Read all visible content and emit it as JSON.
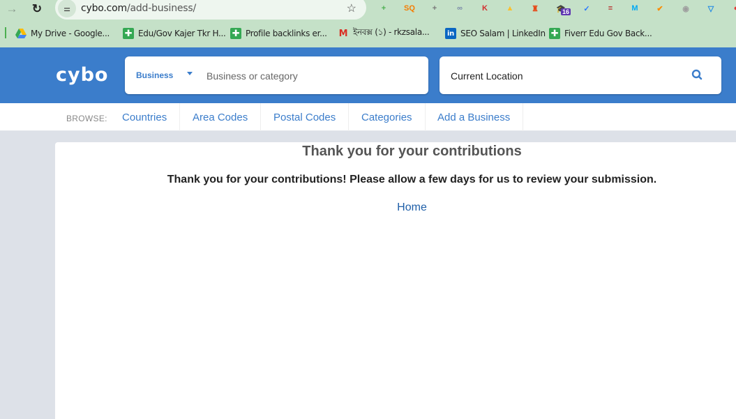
{
  "browser": {
    "url_host": "cybo.com",
    "url_path": "/add-business/",
    "extensions": [
      {
        "name": "extension-plus",
        "glyph": "+",
        "color": "#4caf50"
      },
      {
        "name": "extension-sq",
        "glyph": "SQ",
        "color": "#f57c00"
      },
      {
        "name": "extension-doc-plus",
        "glyph": "+",
        "color": "#777"
      },
      {
        "name": "extension-link",
        "glyph": "∞",
        "color": "#7a8aa8"
      },
      {
        "name": "extension-k",
        "glyph": "K",
        "color": "#d32f2f"
      },
      {
        "name": "extension-bell",
        "glyph": "▲",
        "color": "#fbc02d"
      },
      {
        "name": "extension-lighthouse",
        "glyph": "♜",
        "color": "#e64a19"
      },
      {
        "name": "extension-cap",
        "glyph": "🎓",
        "color": "#5e35b1",
        "badge": "16"
      },
      {
        "name": "extension-calendar",
        "glyph": "✓",
        "color": "#2979ff"
      },
      {
        "name": "extension-flag",
        "glyph": "≡",
        "color": "#b71c1c"
      },
      {
        "name": "extension-m",
        "glyph": "M",
        "color": "#03a9f4"
      },
      {
        "name": "extension-user-check",
        "glyph": "✔",
        "color": "#fb8c00"
      },
      {
        "name": "extension-shield-gray",
        "glyph": "◉",
        "color": "#9e9e9e"
      },
      {
        "name": "extension-shield-blue",
        "glyph": "▽",
        "color": "#1e88e5"
      },
      {
        "name": "extension-pokeball",
        "glyph": "●",
        "color": "#e53935"
      }
    ]
  },
  "bookmarks": [
    {
      "label": "My Drive - Google...",
      "icon": "drive-icon"
    },
    {
      "label": "Edu/Gov Kajer Tkr H...",
      "icon": "sheets-icon"
    },
    {
      "label": "Profile backlinks er...",
      "icon": "sheets-icon"
    },
    {
      "label": "ইনবক্স (১) - rkzsala...",
      "icon": "gmail-icon"
    },
    {
      "label": "SEO Salam | LinkedIn",
      "icon": "linkedin-icon"
    },
    {
      "label": "Fiverr Edu Gov Back...",
      "icon": "sheets-icon"
    }
  ],
  "header": {
    "logo": "cybo",
    "search_type": "Business",
    "search_placeholder": "Business or category",
    "location_placeholder": "Current Location",
    "brand_color": "#3b7dcb"
  },
  "browse": {
    "label": "BROWSE:",
    "links": [
      "Countries",
      "Area Codes",
      "Postal Codes",
      "Categories",
      "Add a Business"
    ]
  },
  "content": {
    "title": "Thank you for your contributions",
    "message": "Thank you for your contributions! Please allow a few days for us to review your submission.",
    "home_link": "Home"
  }
}
